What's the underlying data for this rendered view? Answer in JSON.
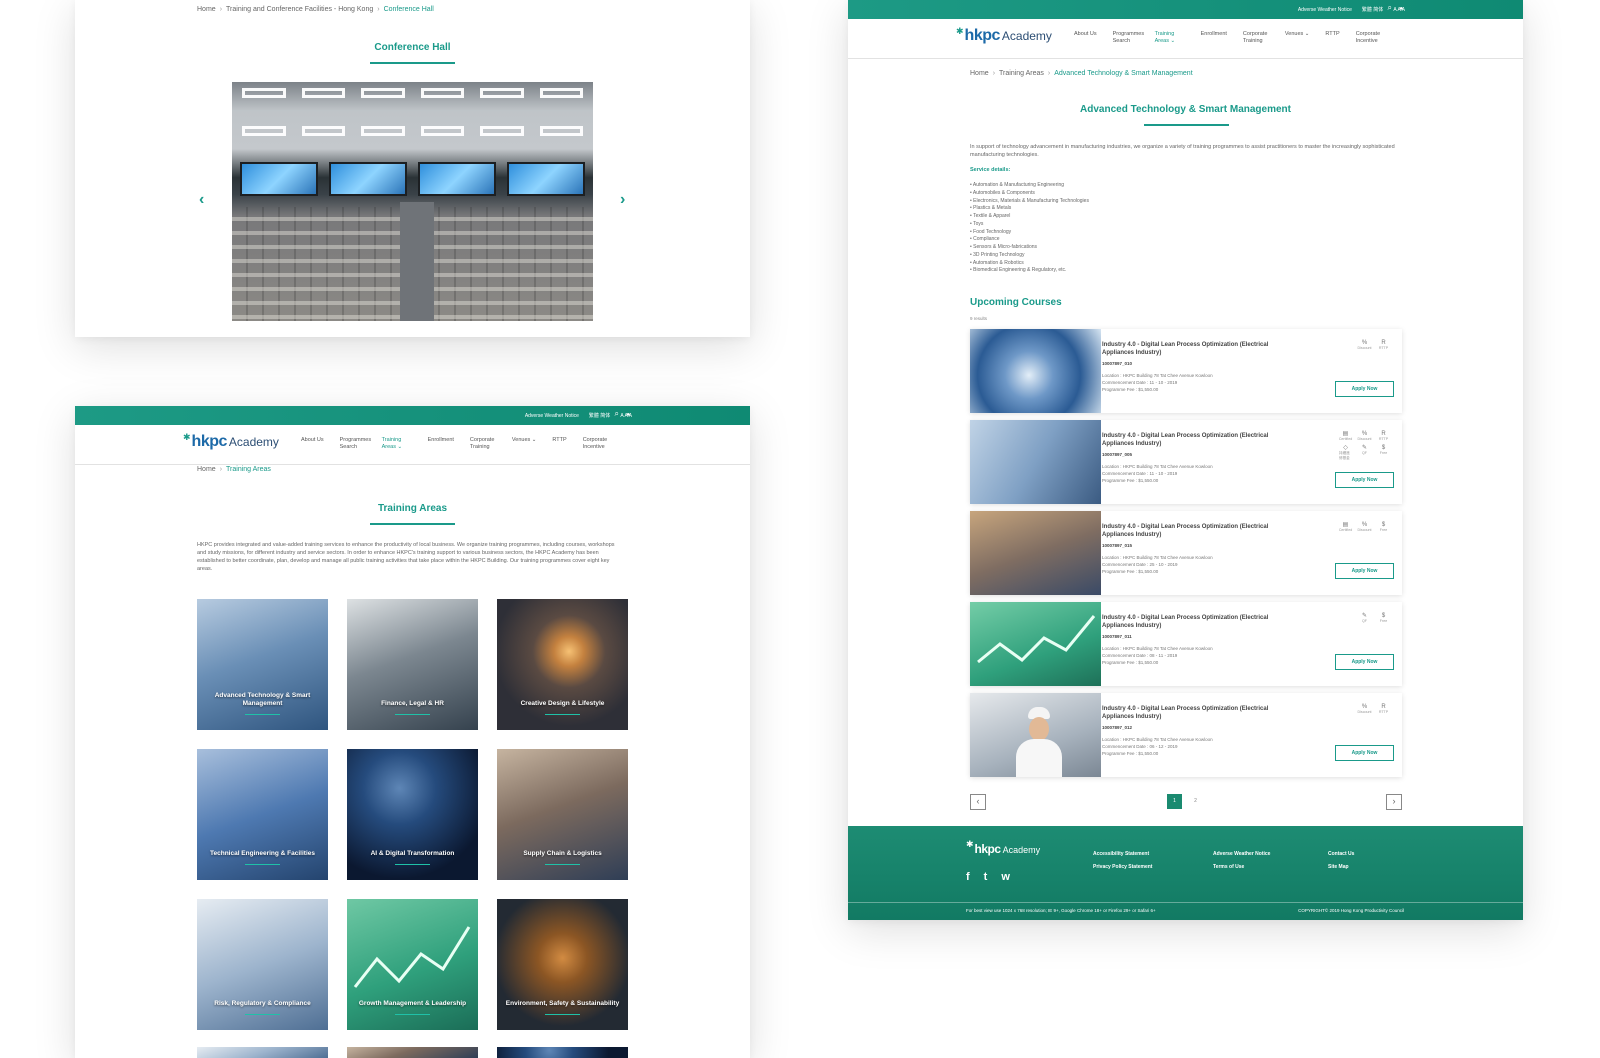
{
  "hall": {
    "crumbs": [
      "Home",
      "Training and Conference Facilities - Hong Kong",
      "Conference Hall"
    ],
    "title": "Conference Hall",
    "prev_arrow": "‹",
    "next_arrow": "›"
  },
  "header": {
    "adverse": "Adverse Weather Notice",
    "lang": "繁體 简体",
    "font_sizes": "A A A",
    "search_icon": "⌕",
    "user_icon": "●",
    "logo_hk": "hkpc",
    "logo_academy": "Academy",
    "nav": [
      {
        "label": "About Us"
      },
      {
        "label": "Programmes Search"
      },
      {
        "label": "Training Areas ⌄"
      },
      {
        "label": "Enrollment"
      },
      {
        "label": "Corporate Training"
      },
      {
        "label": "Venues ⌄"
      },
      {
        "label": "RTTP"
      },
      {
        "label": "Corporate Incentive"
      }
    ]
  },
  "areas": {
    "crumbs": [
      "Home",
      "Training Areas"
    ],
    "title": "Training Areas",
    "intro": "HKPC provides integrated and value-added training services to enhance the productivity of local business. We organize training programmes, including courses, workshops and study missions, for different industry and service sectors. In order to enhance HKPC's training support to various business sectors, the HKPC Academy has been established to better coordinate, plan, develop and manage all public training activities that take place within the HKPC Building. Our training programmes cover eight key areas.",
    "tiles": [
      "Advanced Technology & Smart Management",
      "Finance, Legal & HR",
      "Creative Design & Lifestyle",
      "Technical Engineering & Facilities",
      "AI & Digital Transformation",
      "Supply Chain & Logistics",
      "Risk, Regulatory & Compliance",
      "Growth Management & Leadership",
      "Environment, Safety & Sustainability"
    ]
  },
  "tech": {
    "crumbs": [
      "Home",
      "Training Areas",
      "Advanced Technology & Smart Management"
    ],
    "title": "Advanced Technology & Smart Management",
    "intro": "In support of technology advancement in manufacturing industries, we organize a variety of training programmes to assist practitioners to master the increasingly sophisticated manufacturing technologies.",
    "service_title": "Service details:",
    "services": [
      "Automation & Manufacturing Engineering",
      "Automobiles & Components",
      "Electronics, Materials & Manufacturing Technologies",
      "Plastics & Metals",
      "Textile & Apparel",
      "Toys",
      "Food Technology",
      "Compliance",
      "Sensors & Micro-fabrications",
      "3D Printing Technology",
      "Automation & Robotics",
      "Biomedical Engineering & Regulatory, etc."
    ],
    "upcoming_title": "Upcoming Courses",
    "results": "9 results",
    "courses": [
      {
        "title": "Industry 4.0 - Digital Lean Process Optimization (Electrical Appliances Industry)",
        "code": "10007897_010",
        "location": "Location :  HKPC Building 78 Tat Chee Avenue Kowloon",
        "date": "Commencement Date :  11 - 10 - 2019",
        "fee": "Programme Fee :  $1,550.00",
        "apply": "Apply Now",
        "badges": [
          [
            "%",
            "Discount"
          ],
          [
            "R",
            "RTTP"
          ]
        ]
      },
      {
        "title": "Industry 4.0 - Digital Lean Process Optimization (Electrical Appliances Industry)",
        "code": "10007897_005",
        "location": "Location :  HKPC Building 78 Tat Chee Avenue Kowloon",
        "date": "Commencement Date :  11 - 10 - 2019",
        "fee": "Programme Fee :  $1,550.00",
        "apply": "Apply Now",
        "badges": [
          [
            "▤",
            "Certified"
          ],
          [
            "%",
            "Discount"
          ],
          [
            "R",
            "RTTP"
          ],
          [
            "◇",
            "持續進修基金"
          ],
          [
            "✎",
            "QF"
          ],
          [
            "$",
            "Free"
          ]
        ]
      },
      {
        "title": "Industry 4.0 - Digital Lean Process Optimization (Electrical Appliances Industry)",
        "code": "10007897_015",
        "location": "Location :  HKPC Building 78 Tat Chee Avenue Kowloon",
        "date": "Commencement Date :  25 - 10 - 2019",
        "fee": "Programme Fee :  $1,550.00",
        "apply": "Apply Now",
        "badges": [
          [
            "▤",
            "Certified"
          ],
          [
            "%",
            "Discount"
          ],
          [
            "$",
            "Free"
          ]
        ]
      },
      {
        "title": "Industry 4.0 - Digital Lean Process Optimization (Electrical Appliances Industry)",
        "code": "10007897_011",
        "location": "Location :  HKPC Building 78 Tat Chee Avenue Kowloon",
        "date": "Commencement Date :  08 - 11 - 2019",
        "fee": "Programme Fee :  $1,550.00",
        "apply": "Apply Now",
        "badges": [
          [
            "✎",
            "QF"
          ],
          [
            "$",
            "Free"
          ]
        ]
      },
      {
        "title": "Industry 4.0 - Digital Lean Process Optimization (Electrical Appliances Industry)",
        "code": "10007897_012",
        "location": "Location :  HKPC Building 78 Tat Chee Avenue Kowloon",
        "date": "Commencement Date :  06 - 12 - 2019",
        "fee": "Programme Fee :  $1,550.00",
        "apply": "Apply Now",
        "badges": [
          [
            "%",
            "Discount"
          ],
          [
            "R",
            "RTTP"
          ]
        ]
      }
    ],
    "pager": {
      "prev": "‹",
      "next": "›",
      "pages": [
        "1",
        "2"
      ]
    }
  },
  "footer": {
    "col1": [
      "Accessibility Statement",
      "Privacy Policy Statement"
    ],
    "col2": [
      "Adverse Weather Notice",
      "Terms of Use"
    ],
    "col3": [
      "Contact Us",
      "Site Map"
    ],
    "social": [
      "f",
      "t",
      "w"
    ],
    "best_view": "For best view use 1024 x 768 resolution; IE 9+, Google Chrome 18+ or Firefox 29+ or Safari 6+",
    "copyright": "COPYRIGHT© 2019 Hong Kong Productivity Council"
  },
  "colors": {
    "accent": "#1a9a8a",
    "header_bar": "#1d9a85",
    "footer": "#127a63"
  }
}
